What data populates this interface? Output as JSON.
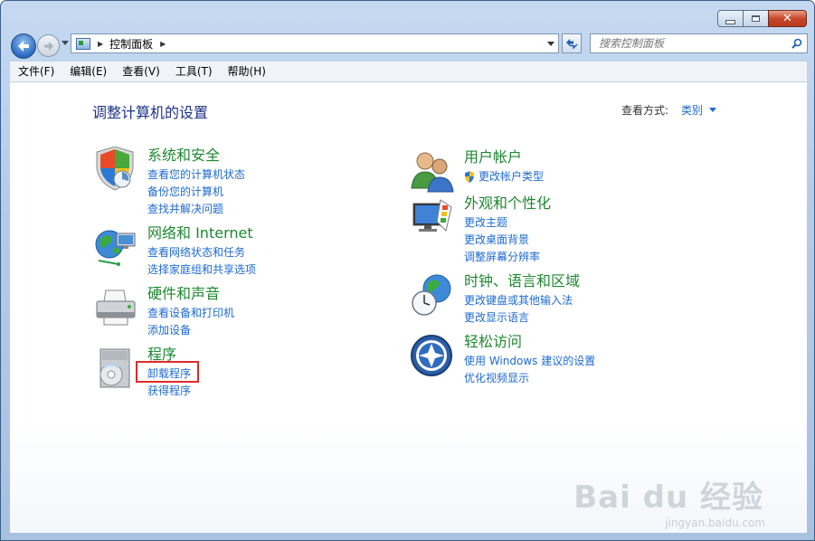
{
  "window": {
    "minimize_icon": "minimize-icon",
    "maximize_icon": "maximize-icon",
    "close_icon": "close-icon"
  },
  "nav": {
    "breadcrumb": "控制面板",
    "search_placeholder": "搜索控制面板"
  },
  "menu": [
    "文件(F)",
    "编辑(E)",
    "查看(V)",
    "工具(T)",
    "帮助(H)"
  ],
  "main": {
    "title": "调整计算机的设置",
    "view_by_label": "查看方式:",
    "view_by_value": "类别"
  },
  "left_categories": [
    {
      "title": "系统和安全",
      "icon": "shield-icon",
      "links": [
        "查看您的计算机状态",
        "备份您的计算机",
        "查找并解决问题"
      ]
    },
    {
      "title": "网络和 Internet",
      "icon": "network-globe-icon",
      "links": [
        "查看网络状态和任务",
        "选择家庭组和共享选项"
      ]
    },
    {
      "title": "硬件和声音",
      "icon": "printer-icon",
      "links": [
        "查看设备和打印机",
        "添加设备"
      ]
    },
    {
      "title": "程序",
      "icon": "programs-disc-icon",
      "links": [
        "卸载程序",
        "获得程序"
      ]
    }
  ],
  "right_categories": [
    {
      "title": "用户帐户",
      "icon": "users-icon",
      "links": [
        "更改帐户类型"
      ]
    },
    {
      "title": "外观和个性化",
      "icon": "monitor-palette-icon",
      "links": [
        "更改主题",
        "更改桌面背景",
        "调整屏幕分辨率"
      ]
    },
    {
      "title": "时钟、语言和区域",
      "icon": "clock-globe-icon",
      "links": [
        "更改键盘或其他输入法",
        "更改显示语言"
      ]
    },
    {
      "title": "轻松访问",
      "icon": "ease-of-access-icon",
      "links": [
        "使用 Windows 建议的设置",
        "优化视频显示"
      ]
    }
  ],
  "watermark": {
    "main": "Bai du 经验",
    "sub": "jingyan.baidu.com"
  },
  "colors": {
    "category_title": "#1e8830",
    "link": "#1d6ad2",
    "page_title": "#1e3287",
    "highlight": "#e02a2a"
  }
}
